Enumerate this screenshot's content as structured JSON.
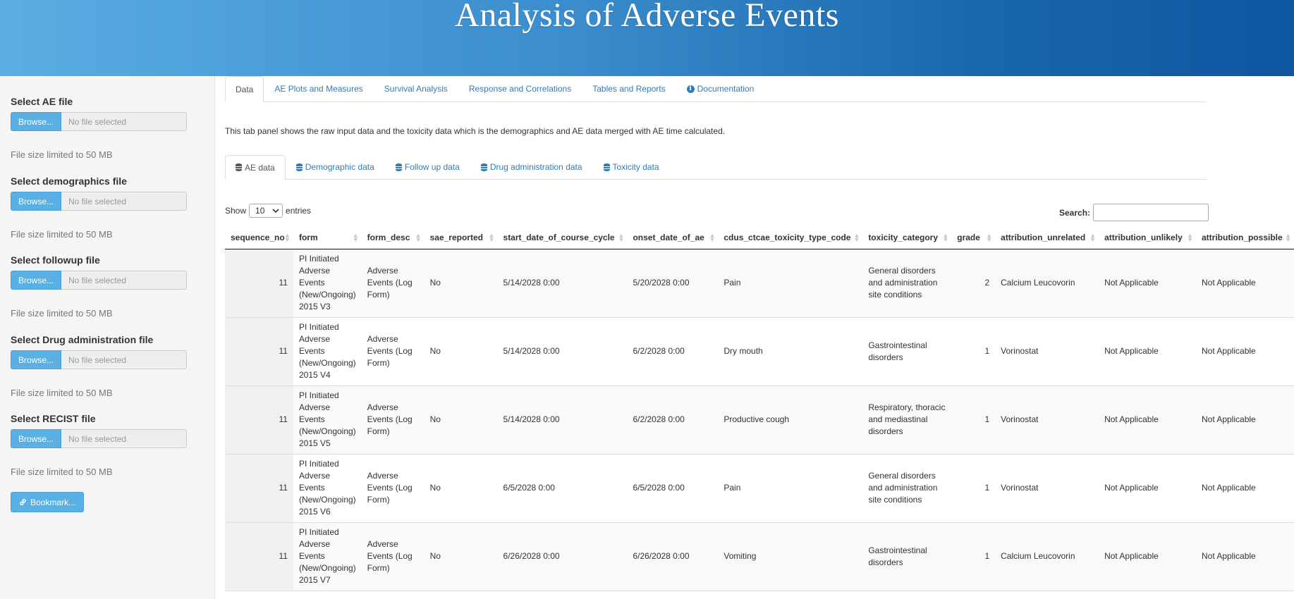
{
  "header": {
    "title": "Analysis of Adverse Events"
  },
  "sidebar": {
    "file_inputs": [
      {
        "label": "Select AE file",
        "browse": "Browse...",
        "placeholder": "No file selected",
        "help": "File size limited to 50 MB"
      },
      {
        "label": "Select demographics file",
        "browse": "Browse...",
        "placeholder": "No file selected",
        "help": "File size limited to 50 MB"
      },
      {
        "label": "Select followup file",
        "browse": "Browse...",
        "placeholder": "No file selected",
        "help": "File size limited to 50 MB"
      },
      {
        "label": "Select Drug administration file",
        "browse": "Browse...",
        "placeholder": "No file selected",
        "help": "File size limited to 50 MB"
      },
      {
        "label": "Select RECIST file",
        "browse": "Browse...",
        "placeholder": "No file selected",
        "help": "File size limited to 50 MB"
      }
    ],
    "bookmark": "Bookmark..."
  },
  "main": {
    "tabs": [
      "Data",
      "AE Plots and Measures",
      "Survival Analysis",
      "Response and Correlations",
      "Tables and Reports",
      "Documentation"
    ],
    "active_tab": "Data",
    "description": "This tab panel shows the raw input data and the toxicity data which is the demographics and AE data merged with AE time calculated.",
    "subtabs": [
      "AE data",
      "Demographic data",
      "Follow up data",
      "Drug administration data",
      "Toxicity data"
    ],
    "active_subtab": "AE data",
    "show_label": "Show",
    "entries_value": "10",
    "entries_label": "entries",
    "search_label": "Search:"
  },
  "table": {
    "columns": [
      "sequence_no",
      "form",
      "form_desc",
      "sae_reported",
      "start_date_of_course_cycle",
      "onset_date_of_ae",
      "cdus_ctcae_toxicity_type_code",
      "toxicity_category",
      "grade",
      "attribution_unrelated",
      "attribution_unlikely",
      "attribution_possible"
    ],
    "rows": [
      [
        "11",
        "PI Initiated Adverse Events (New/Ongoing) 2015 V3",
        "Adverse Events (Log Form)",
        "No",
        "5/14/2028 0:00",
        "5/20/2028 0:00",
        "Pain",
        "General disorders and administration site conditions",
        "2",
        "Calcium Leucovorin",
        "Not Applicable",
        "Not Applicable"
      ],
      [
        "11",
        "PI Initiated Adverse Events (New/Ongoing) 2015 V4",
        "Adverse Events (Log Form)",
        "No",
        "5/14/2028 0:00",
        "6/2/2028 0:00",
        "Dry mouth",
        "Gastrointestinal disorders",
        "1",
        "Vorinostat",
        "Not Applicable",
        "Not Applicable"
      ],
      [
        "11",
        "PI Initiated Adverse Events (New/Ongoing) 2015 V5",
        "Adverse Events (Log Form)",
        "No",
        "5/14/2028 0:00",
        "6/2/2028 0:00",
        "Productive cough",
        "Respiratory, thoracic and mediastinal disorders",
        "1",
        "Vorinostat",
        "Not Applicable",
        "Not Applicable"
      ],
      [
        "11",
        "PI Initiated Adverse Events (New/Ongoing) 2015 V6",
        "Adverse Events (Log Form)",
        "No",
        "6/5/2028 0:00",
        "6/5/2028 0:00",
        "Pain",
        "General disorders and administration site conditions",
        "1",
        "Vorinostat",
        "Not Applicable",
        "Not Applicable"
      ],
      [
        "11",
        "PI Initiated Adverse Events (New/Ongoing) 2015 V7",
        "Adverse Events (Log Form)",
        "No",
        "6/26/2028 0:00",
        "6/26/2028 0:00",
        "Vomiting",
        "Gastrointestinal disorders",
        "1",
        "Calcium Leucovorin",
        "Not Applicable",
        "Not Applicable"
      ]
    ]
  },
  "colors": {
    "accent": "#5bb0e3",
    "link": "#337ab7",
    "header_start": "#5aaee3",
    "header_end": "#0f56a0"
  },
  "icons": {
    "bookmark": "link-icon",
    "documentation": "info-circle-icon",
    "subtabs": "database-icon"
  }
}
